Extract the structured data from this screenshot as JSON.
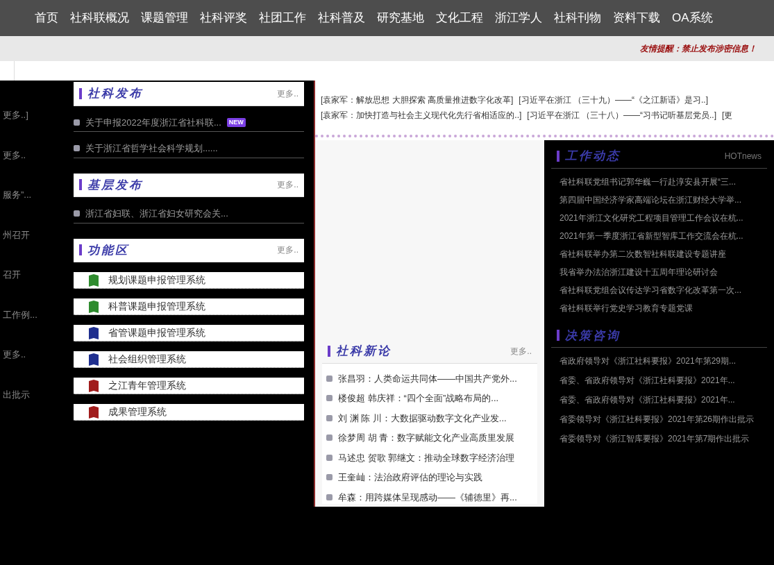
{
  "nav": [
    "首页",
    "社科联概况",
    "课题管理",
    "社科评奖",
    "社团工作",
    "社科普及",
    "研究基地",
    "文化工程",
    "浙江学人",
    "社科刊物",
    "资料下载",
    "OA系统"
  ],
  "notice": "友情提醒：禁止发布涉密信息！",
  "left_fragments": [
    "更多..]",
    "更多..",
    "服务”...",
    "州召开",
    "召开",
    "工作例...",
    "更多..",
    "出批示"
  ],
  "panels": [
    {
      "title": "社科发布",
      "more": "更多..",
      "items": [
        {
          "text": "关于申报2022年度浙江省社科联...",
          "badge": "NEW"
        },
        {
          "text": "关于浙江省哲学社会科学规划......"
        }
      ]
    },
    {
      "title": "基层发布",
      "more": "更多..",
      "items": [
        {
          "text": "浙江省妇联、浙江省妇女研究会关..."
        }
      ]
    }
  ],
  "systems": {
    "title": "功能区",
    "more": "更多..",
    "items": [
      {
        "label": "规划课题申报管理系统",
        "color": "#2e8b2e"
      },
      {
        "label": "科普课题申报管理系统",
        "color": "#2e8b2e"
      },
      {
        "label": "省管课题申报管理系统",
        "color": "#1f2f8f"
      },
      {
        "label": "社会组织管理系统",
        "color": "#1f2f8f"
      },
      {
        "label": "之江青年管理系统",
        "color": "#a11c1c"
      },
      {
        "label": "成果管理系统",
        "color": "#a11c1c"
      }
    ]
  },
  "headlines": [
    [
      "[袁家军：解放思想 大胆探索 高质量推进数字化改革]",
      "[习近平在浙江 （三十九）——“《之江新语》是习..]"
    ],
    [
      "[袁家军：加快打造与社会主义现代化先行省相适应的..]",
      "[习近平在浙江 （三十八）——“习书记听基层党员..]",
      "[更"
    ]
  ],
  "theory": {
    "title": "社科新论",
    "more": "更多..",
    "items": [
      "张昌羽：人类命运共同体——中国共产党外...",
      "楼俊超 韩庆祥：“四个全面”战略布局的...",
      "刘 渊 陈 川：大数据驱动数字文化产业发...",
      "徐梦周 胡 青：数字赋能文化产业高质里发展",
      "马述忠 贺歌 郭继文：推动全球数字经济治理",
      "王奎屾：法治政府评估的理论与实践",
      "牟森：用跨媒体呈现感动——《辅德里》再..."
    ]
  },
  "work_news": {
    "title": "工作动态",
    "tag": "HOTnews",
    "items": [
      "省社科联党组书记郭华巍一行赴淳安县开展“三...",
      "第四届中国经济学家高端论坛在浙江财经大学举...",
      "2021年浙江文化研究工程项目管理工作会议在杭...",
      "2021年第一季度浙江省新型智库工作交流会在杭...",
      "省社科联举办第二次数智社科联建设专题讲座",
      "我省举办法治浙江建设十五周年理论研讨会",
      "省社科联党组会议传达学习省数字化改革第一次...",
      "省社科联举行党史学习教育专题党课"
    ]
  },
  "consult": {
    "title": "决策咨询",
    "items": [
      "省政府领导对《浙江社科要报》2021年第29期...",
      "省委、省政府领导对《浙江社科要报》2021年...",
      "省委、省政府领导对《浙江社科要报》2021年...",
      "省委领导对《浙江社科要报》2021年第26期作出批示",
      "省委领导对《浙江智库要报》2021年第7期作出批示"
    ]
  }
}
